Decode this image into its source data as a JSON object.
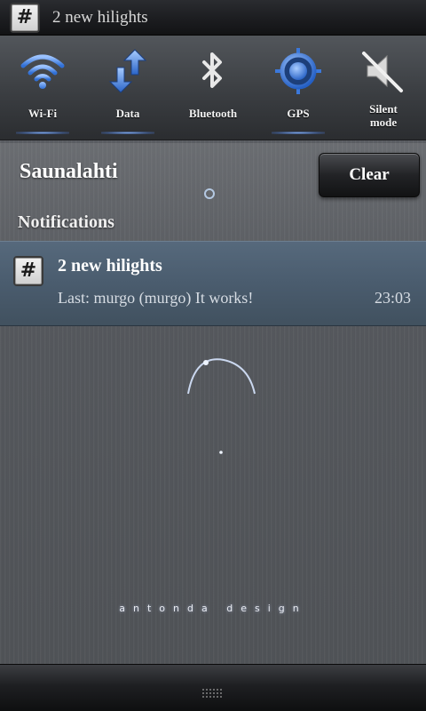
{
  "status_bar": {
    "icon": "hash-icon",
    "hash_glyph": "#",
    "title": "2 new hilights"
  },
  "quick_settings": {
    "items": [
      {
        "label": "Wi-Fi",
        "icon": "wifi-icon",
        "active": true
      },
      {
        "label": "Data",
        "icon": "data-arrows-icon",
        "active": true
      },
      {
        "label": "Bluetooth",
        "icon": "bluetooth-icon",
        "active": false
      },
      {
        "label": "GPS",
        "icon": "gps-icon",
        "active": true
      },
      {
        "label": "Silent mode",
        "label_lines": [
          "Silent",
          "mode"
        ],
        "icon": "silent-mode-icon",
        "active": false
      }
    ]
  },
  "header": {
    "carrier": "Saunalahti",
    "clear_label": "Clear"
  },
  "notifications": {
    "section_title": "Notifications",
    "items": [
      {
        "icon": "hash-icon",
        "hash_glyph": "#",
        "title": "2 new hilights",
        "text": "Last: murgo (murgo) It works!",
        "time": "23:03"
      }
    ]
  },
  "branding": {
    "text": "antonda design"
  },
  "colors": {
    "accent": "#3f7fe0",
    "notification_bg": "#4a5c6e",
    "background": "#55585d"
  }
}
